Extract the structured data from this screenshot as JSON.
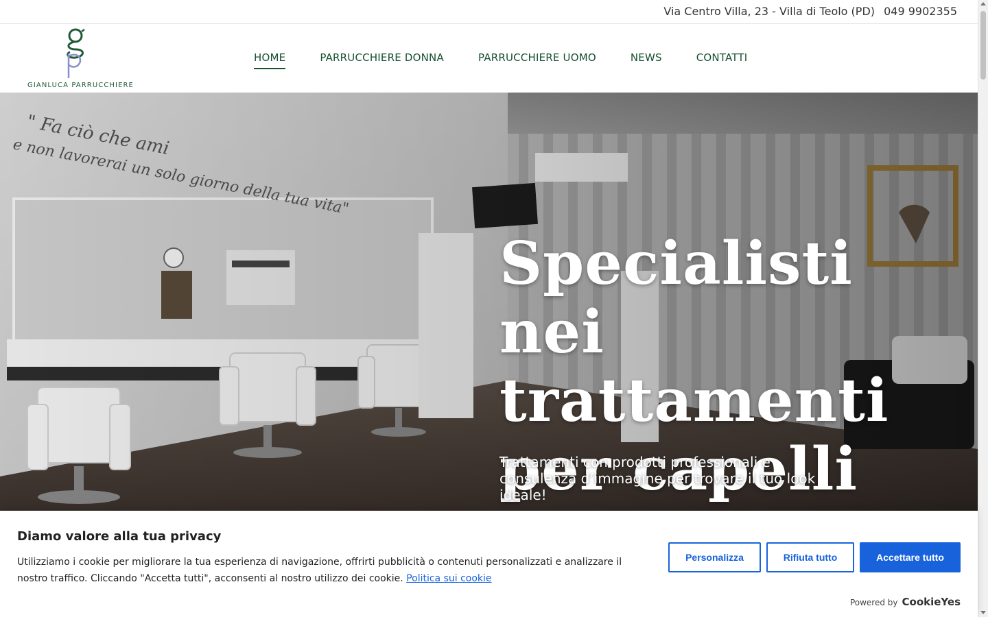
{
  "topbar": {
    "address": "Via Centro Villa, 23 - Villa di Teolo (PD)",
    "phone": "049 9902355"
  },
  "logo": {
    "brand": "GIANLUCA PARRUCCHIERE",
    "colors": {
      "green": "#1e5a36",
      "violet": "#8a8fc9"
    }
  },
  "nav": {
    "items": [
      {
        "label": "HOME",
        "active": true
      },
      {
        "label": "PARRUCCHIERE DONNA",
        "active": false
      },
      {
        "label": "PARRUCCHIERE UOMO",
        "active": false
      },
      {
        "label": "NEWS",
        "active": false
      },
      {
        "label": "CONTATTI",
        "active": false
      }
    ],
    "color": "#16502f"
  },
  "hero": {
    "headline": "Specialisti nei trattamenti per capelli",
    "subline": "Trattamenti con prodotti professionali e consulenza d’immagine per trovare il tuo look ideale!",
    "wall_quote_line1": "\" Fa ciò che ami",
    "wall_quote_line2": "e non lavorerai un solo giorno della tua vita\""
  },
  "cookie": {
    "title": "Diamo valore alla tua privacy",
    "description": "Utilizziamo i cookie per migliorare la tua esperienza di navigazione, offrirti pubblicità o contenuti personalizzati e analizzare il nostro traffico. Cliccando \"Accetta tutti\", acconsenti al nostro utilizzo dei cookie.",
    "policy_link": "Politica sui cookie",
    "buttons": {
      "customize": "Personalizza",
      "reject": "Rifiuta tutto",
      "accept": "Accettare tutto"
    },
    "powered_by": "Powered by",
    "powered_brand": "CookieYes",
    "accent": "#1863dc"
  }
}
